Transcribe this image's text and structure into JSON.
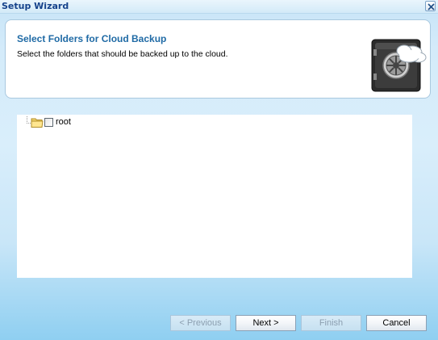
{
  "window": {
    "title": "Setup Wizard"
  },
  "header": {
    "title": "Select Folders for Cloud Backup",
    "description": "Select the folders that should be backed up to the cloud."
  },
  "tree": {
    "items": [
      {
        "label": "root",
        "checked": false,
        "icon": "folder-icon"
      }
    ]
  },
  "buttons": {
    "previous": "< Previous",
    "next": "Next >",
    "finish": "Finish",
    "cancel": "Cancel"
  },
  "colors": {
    "title_text": "#15428b",
    "header_title": "#1f6aa5",
    "background": "#d4ebfa"
  }
}
